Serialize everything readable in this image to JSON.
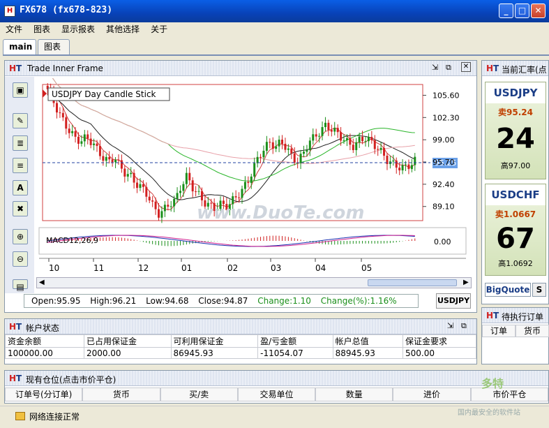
{
  "window": {
    "title": "FX678 (fx678-823)",
    "min": "_",
    "max": "□",
    "close": "✕"
  },
  "menu": [
    "文件",
    "图表",
    "显示报表",
    "其他选择",
    "关于"
  ],
  "tabs": [
    "main",
    "图表"
  ],
  "inner_frame": {
    "title": "Trade Inner Frame",
    "logo": "HT"
  },
  "chart": {
    "legend": "USDJPY  Day  Candle Stick",
    "price_ticks": [
      "105.60",
      "102.30",
      "99.00",
      "95.70",
      "92.40",
      "89.10"
    ],
    "current_price": "95.25",
    "macd_label": "MACD12,26,9",
    "macd_tick": "0.00",
    "months": [
      "10",
      "11",
      "12",
      "01",
      "02",
      "03",
      "04",
      "05"
    ],
    "watermark": "www.DuoTe.com"
  },
  "chart_data": {
    "type": "candlestick",
    "title": "USDJPY  Day  Candle Stick",
    "y_ticks": [
      105.6,
      102.3,
      99.0,
      95.7,
      92.4,
      89.1
    ],
    "ylim": [
      87.0,
      107.2
    ],
    "x_labels": [
      "10",
      "11",
      "12",
      "01",
      "02",
      "03",
      "04",
      "05"
    ],
    "last_price": 95.25,
    "close_series_approx": [
      106.5,
      104.8,
      103.0,
      101.5,
      100.2,
      99.2,
      98.8,
      99.4,
      98.6,
      97.4,
      96.3,
      95.7,
      96.5,
      95.0,
      94.0,
      93.5,
      92.4,
      91.8,
      90.8,
      89.0,
      88.0,
      88.7,
      89.6,
      90.0,
      92.2,
      93.6,
      92.0,
      91.0,
      89.8,
      89.3,
      88.8,
      89.5,
      89.0,
      89.8,
      90.6,
      91.6,
      92.8,
      94.8,
      96.6,
      97.8,
      98.6,
      97.9,
      98.8,
      97.7,
      96.3,
      95.8,
      97.0,
      98.8,
      99.4,
      100.3,
      101.1,
      100.6,
      100.0,
      99.2,
      98.5,
      98.0,
      98.9,
      99.3,
      98.8,
      98.0,
      97.1,
      96.0,
      95.4,
      95.0,
      94.8,
      95.2,
      95.9
    ],
    "macd_zero": "0.00"
  },
  "ohlc": {
    "open": "Open:95.95",
    "high": "High:96.21",
    "low": "Low:94.68",
    "close": "Close:94.87",
    "change": "Change:1.10",
    "change_pct": "Change(%):1.16%"
  },
  "symbol_button": "USDJPY",
  "rates_panel": {
    "title": "当前汇率(点",
    "quotes": [
      {
        "symbol": "USDJPY",
        "sell": "卖95.24",
        "big": "24",
        "high": "高97.00"
      },
      {
        "symbol": "USDCHF",
        "sell": "卖1.0667",
        "big": "67",
        "high": "高1.0692"
      }
    ],
    "tab_bigquote": "BigQuote",
    "tab_s": "S"
  },
  "account": {
    "title": "帐户状态",
    "headers": [
      "资金余额",
      "已占用保证金",
      "可利用保证金",
      "盈/亏金额",
      "帐户总值",
      "保证金要求"
    ],
    "values": [
      "100000.00",
      "2000.00",
      "86945.93",
      "-11054.07",
      "88945.93",
      "500.00"
    ]
  },
  "pending": {
    "title": "待执行订单",
    "headers": [
      "订单",
      "货币"
    ]
  },
  "positions": {
    "title": "现有仓位(点击市价平仓)",
    "headers": [
      "订单号(分订单)",
      "货币",
      "买/卖",
      "交易单位",
      "数量",
      "进价",
      "市价平仓"
    ]
  },
  "footer": {
    "status": "网络连接正常",
    "brand": "多特",
    "brand_sub": "国内最安全的软件站"
  },
  "colors": {
    "bull": "#1a8f1a",
    "bear": "#d22020",
    "ma_black": "#222222",
    "ma_green": "#2ab52a",
    "ma_pink": "#e8a0a8",
    "current_price_bg": "#6aa0e8"
  }
}
